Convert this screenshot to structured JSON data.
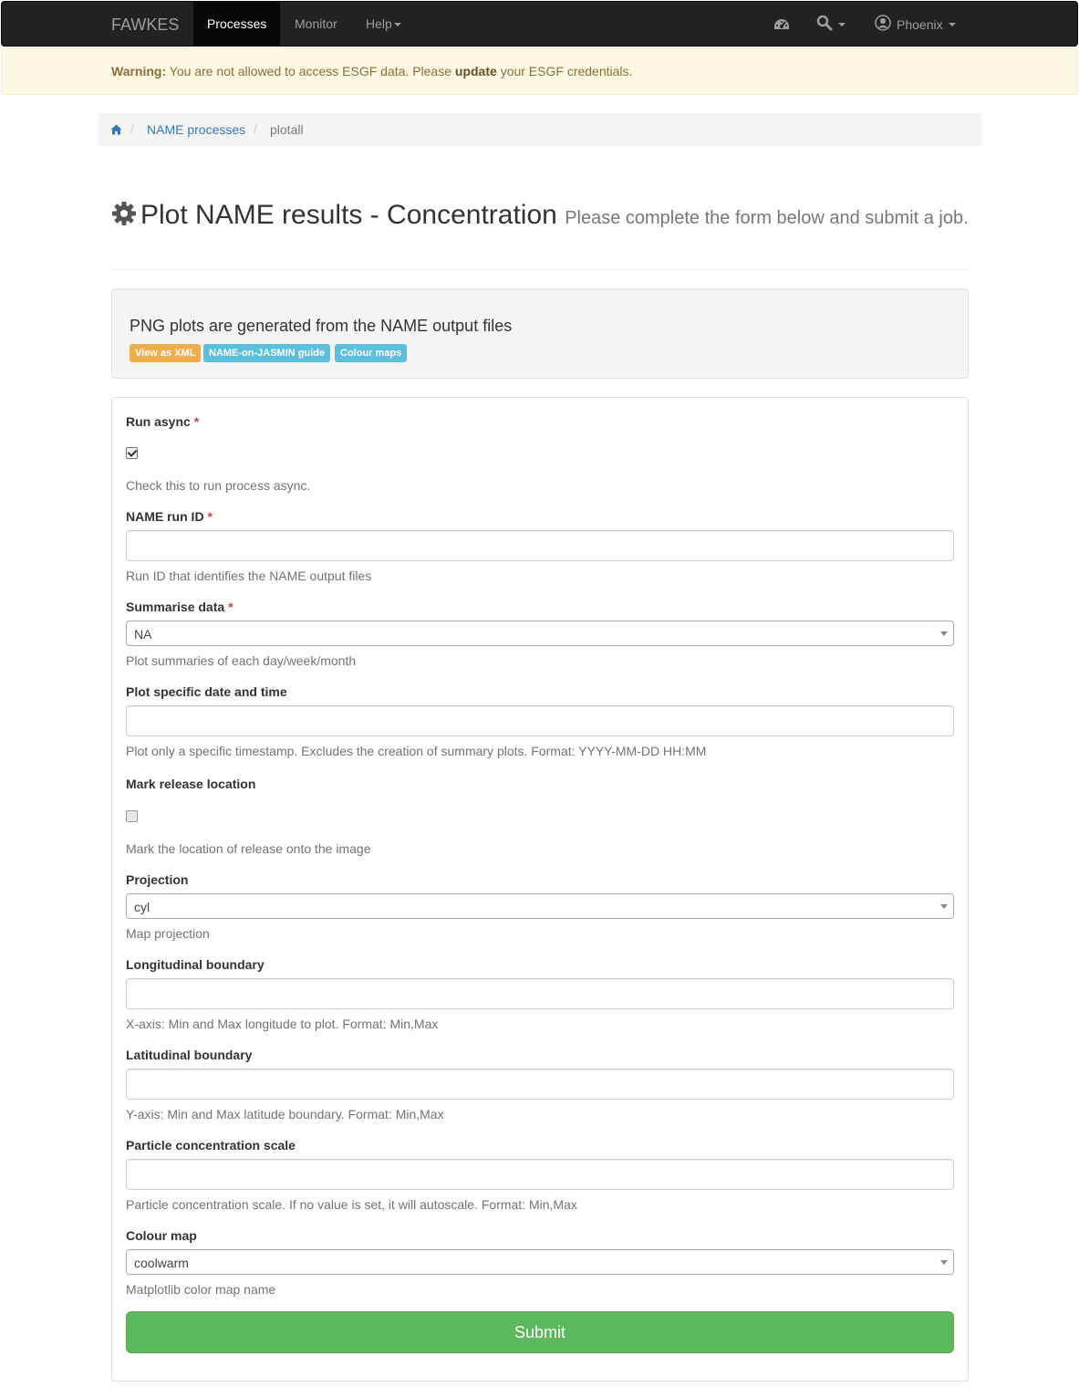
{
  "navbar": {
    "brand": "FAWKES",
    "items": [
      {
        "label": "Processes",
        "active": true
      },
      {
        "label": "Monitor",
        "active": false
      },
      {
        "label": "Help",
        "active": false,
        "dropdown": true
      }
    ],
    "icons": [
      "dashboard-icon",
      "search-icon"
    ],
    "user": {
      "label": "Phoenix",
      "icon": "user-circle-icon"
    }
  },
  "alert": {
    "prefix": "Warning:",
    "text_before": "You are not allowed to access ESGF data. Please",
    "link": "update",
    "text_after": "your ESGF credentials."
  },
  "breadcrumb": {
    "home_icon": "home-icon",
    "items": [
      "NAME processes",
      "plotall"
    ],
    "separator": "/"
  },
  "header": {
    "icon": "gear-icon",
    "title": "Plot NAME results - Concentration",
    "subtitle": "Please complete the form below and submit a job."
  },
  "info": {
    "description": "PNG plots are generated from the NAME output files",
    "labels": [
      {
        "text": "View as XML",
        "color": "#f0ad4e"
      },
      {
        "text": "NAME-on-JASMIN guide",
        "color": "#5bc0de"
      },
      {
        "text": "Colour maps",
        "color": "#5bc0de"
      }
    ]
  },
  "form": {
    "required_marker": "*",
    "fields": [
      {
        "label": "Run async",
        "required": true,
        "type": "checkbox",
        "checked": true,
        "help": "Check this to run process async."
      },
      {
        "label": "NAME run ID",
        "required": true,
        "type": "text",
        "value": "",
        "help": "Run ID that identifies the NAME output files"
      },
      {
        "label": "Summarise data",
        "required": true,
        "type": "select",
        "value": "NA",
        "help": "Plot summaries of each day/week/month"
      },
      {
        "label": "Plot specific date and time",
        "required": false,
        "type": "text",
        "value": "",
        "help": "Plot only a specific timestamp. Excludes the creation of summary plots. Format: YYYY-MM-DD HH:MM"
      },
      {
        "label": "Mark release location",
        "required": false,
        "type": "checkbox",
        "checked": false,
        "help": "Mark the location of release onto the image"
      },
      {
        "label": "Projection",
        "required": false,
        "type": "select",
        "value": "cyl",
        "help": "Map projection"
      },
      {
        "label": "Longitudinal boundary",
        "required": false,
        "type": "text",
        "value": "",
        "help": "X-axis: Min and Max longitude to plot. Format: Min,Max"
      },
      {
        "label": "Latitudinal boundary",
        "required": false,
        "type": "text",
        "value": "",
        "help": "Y-axis: Min and Max latitude boundary. Format: Min,Max"
      },
      {
        "label": "Particle concentration scale",
        "required": false,
        "type": "text",
        "value": "",
        "help": "Particle concentration scale. If no value is set, it will autoscale. Format: Min,Max"
      },
      {
        "label": "Colour map",
        "required": false,
        "type": "select",
        "value": "coolwarm",
        "help": "Matplotlib color map name"
      }
    ],
    "submit_label": "Submit"
  }
}
